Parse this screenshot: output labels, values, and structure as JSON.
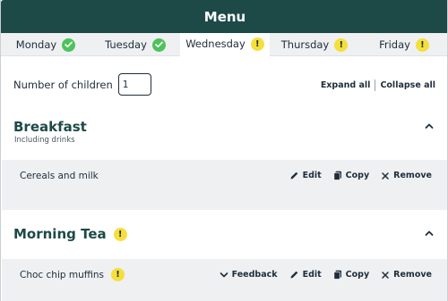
{
  "header": {
    "title": "Menu"
  },
  "tabs": [
    {
      "label": "Monday",
      "status": "complete"
    },
    {
      "label": "Tuesday",
      "status": "complete"
    },
    {
      "label": "Wednesday",
      "status": "warning",
      "active": true
    },
    {
      "label": "Thursday",
      "status": "warning"
    },
    {
      "label": "Friday",
      "status": "warning"
    }
  ],
  "children": {
    "label": "Number of children",
    "value": "1"
  },
  "toolbar": {
    "expand_all": "Expand all",
    "collapse_all": "Collapse all"
  },
  "sections": [
    {
      "title": "Breakfast",
      "subtitle": "Including drinks",
      "items": [
        {
          "label": "Cereals and milk",
          "actions": [
            "Edit",
            "Copy",
            "Remove"
          ]
        }
      ]
    },
    {
      "title": "Morning Tea",
      "warning": "!",
      "items": [
        {
          "label": "Choc chip muffins",
          "warning": "!",
          "actions": [
            "Feedback",
            "Edit",
            "Copy",
            "Remove"
          ]
        }
      ]
    }
  ],
  "warning_glyph": "!",
  "colors": {
    "header_bg": "#1d4a47",
    "ok": "#4cc35b",
    "warn": "#f5df3b",
    "row_bg": "#eef0f2"
  }
}
